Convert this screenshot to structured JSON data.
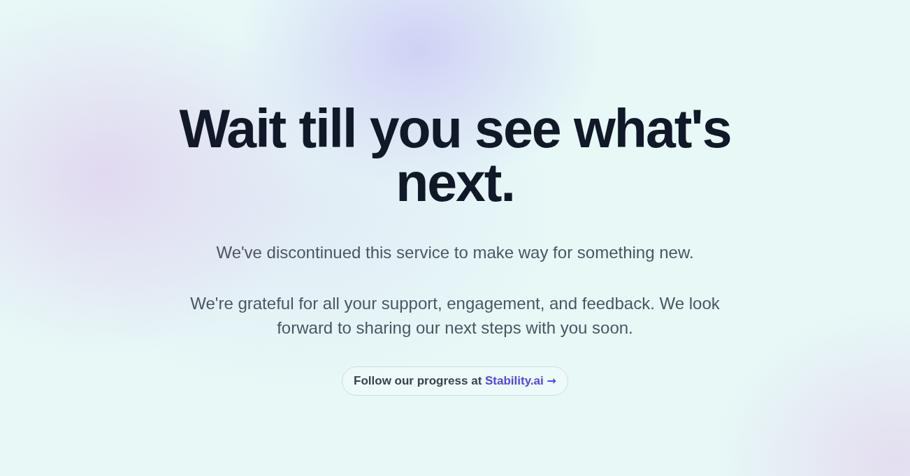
{
  "heading": "Wait till you see what's next.",
  "paragraphs": [
    "We've discontinued this service to make way for something new.",
    "We're grateful for all your support, engagement, and feedback. We look forward to sharing our next steps with you soon."
  ],
  "progress_link": {
    "label": "Follow our progress at",
    "site": "Stability.ai",
    "arrow": "→"
  }
}
